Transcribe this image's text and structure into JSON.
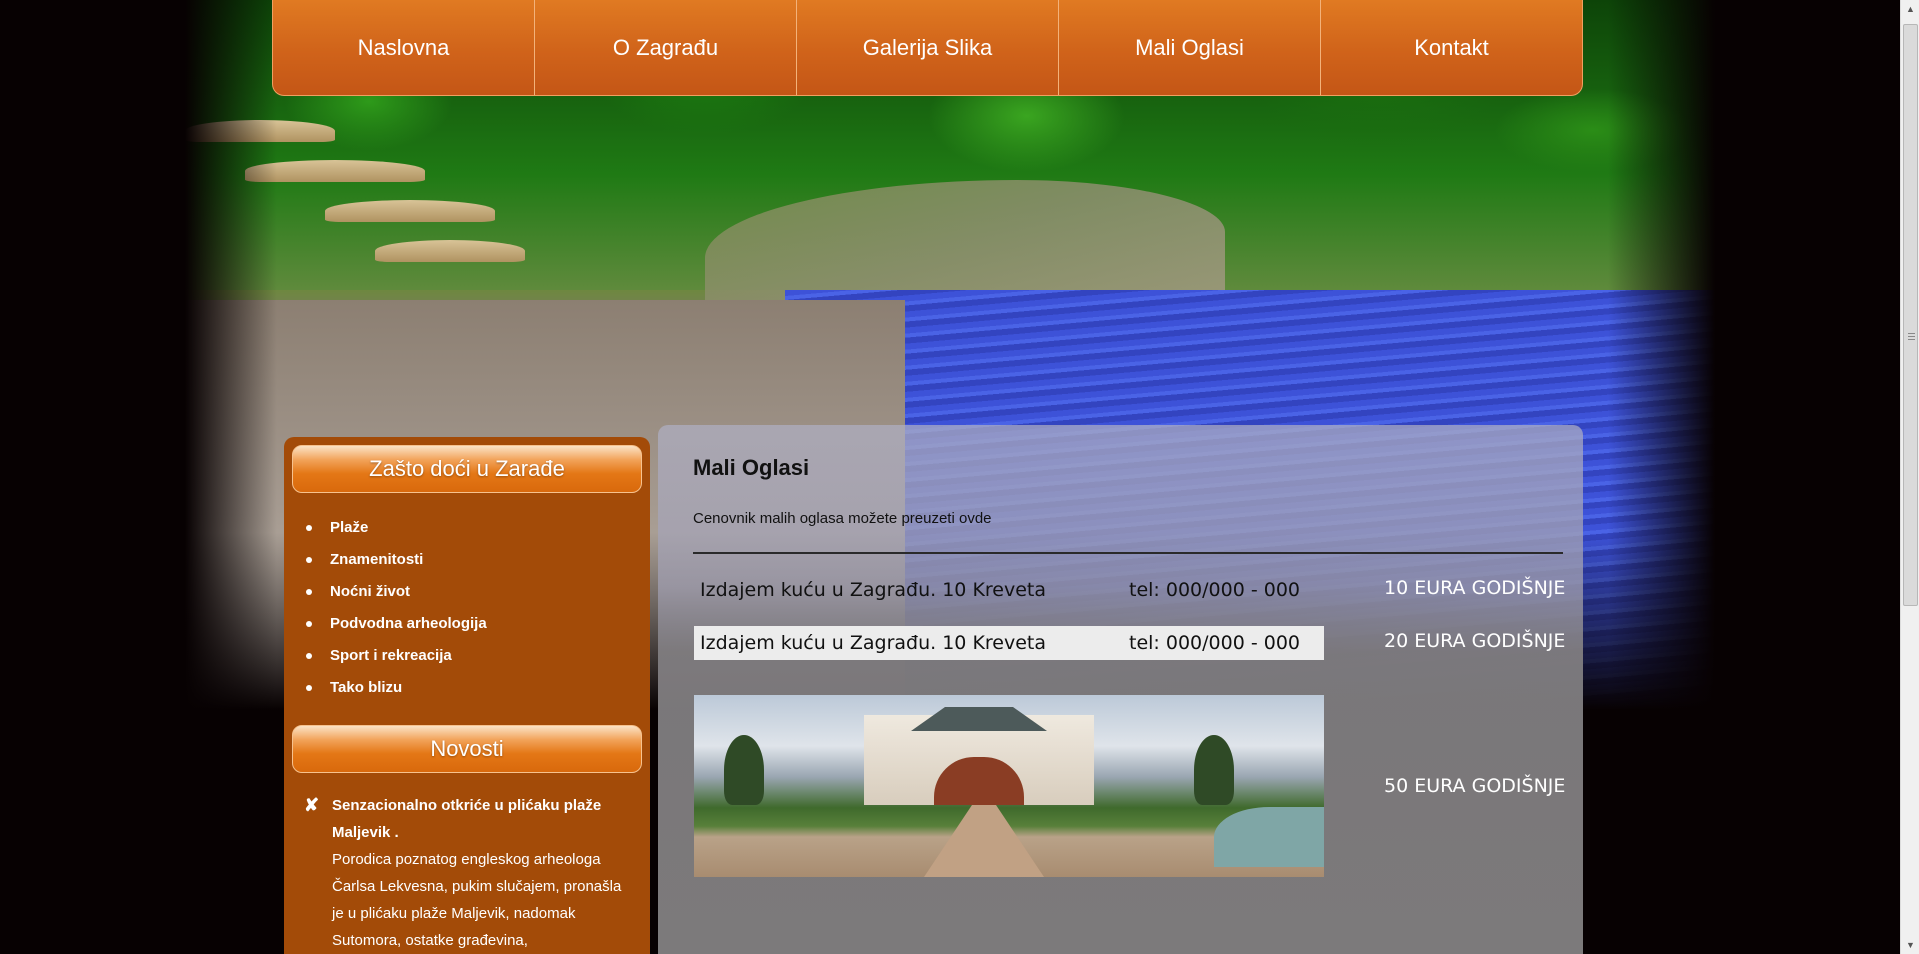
{
  "nav": {
    "items": [
      "Naslovna",
      "O Zagrađu",
      "Galerija Slika",
      "Mali Oglasi",
      "Kontakt"
    ]
  },
  "sidebar": {
    "why_title": "Zašto doći u Zarađe",
    "why_items": [
      "Plaže",
      "Znamenitosti",
      "Noćni život",
      "Podvodna arheologija",
      "Sport i rekreacija",
      "Tako blizu"
    ],
    "news_title": "Novosti",
    "news": {
      "headline": "Senzacionalno otkriće u plićaku plaže Maljevik .",
      "body": "Porodica poznatog engleskog arheologa Čarlsa Lekvesna, pukim slučajem, pronašla je u plićaku plaže Maljevik, nadomak Sutomora, ostatke građevina,"
    }
  },
  "content": {
    "title": "Mali Oglasi",
    "note": "Cenovnik malih oglasa možete preuzeti ovde",
    "ads": [
      {
        "title": "Izdajem kuću u Zagrađu. 10 Kreveta",
        "phone": "tel: 000/000 - 000",
        "price": "10 EURA GODIŠNJE"
      },
      {
        "title": "Izdajem kuću u Zagrađu. 10 Kreveta",
        "phone": "tel: 000/000 - 000",
        "price": "20 EURA GODIŠNJE"
      }
    ],
    "photo_ad_price": "50 EURA GODIŠNJE"
  },
  "colors": {
    "nav_orange": "#d0631a",
    "sidebar_brown": "#a34b08",
    "panel_grey": "#7c7a7b",
    "page_bg": "#070102"
  }
}
